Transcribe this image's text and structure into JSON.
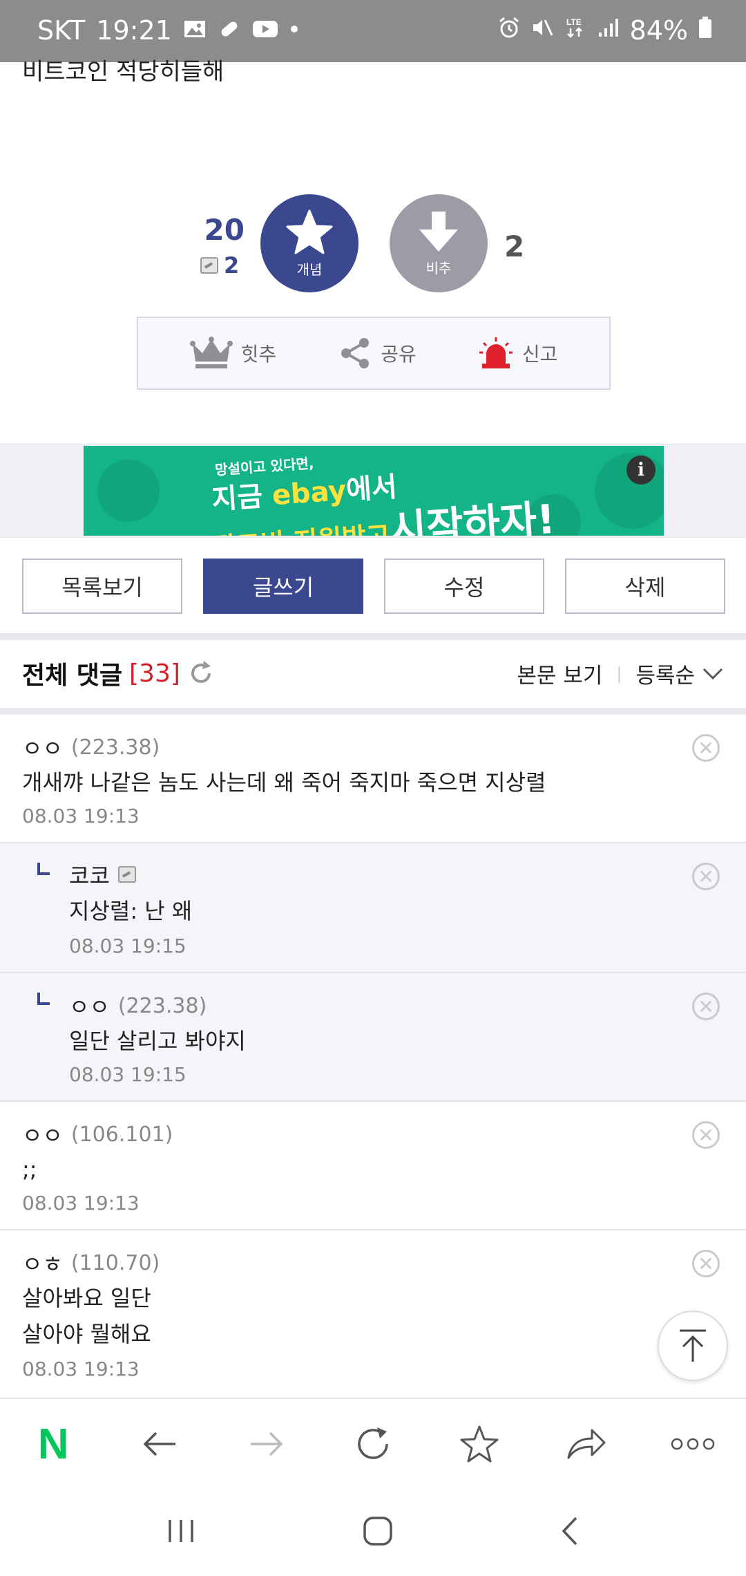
{
  "status_bar": {
    "carrier": "SKT",
    "time": "19:21",
    "network": "LTE",
    "battery": "84%"
  },
  "post": {
    "text_partial": "비트코인 적당히들해"
  },
  "recommend": {
    "up_count": "20",
    "fix_count": "2",
    "up_label": "개념",
    "down_label": "비추",
    "down_count": "2"
  },
  "actions": {
    "hit": "힛추",
    "share": "공유",
    "report": "신고"
  },
  "ad": {
    "line1": "망설이고 있다면,",
    "line2a": "지금 ",
    "line2b": "ebay",
    "line2c": "에서",
    "line3a": "광고비 지원받고",
    "line3b": "시작하자!",
    "info": "i"
  },
  "buttons": {
    "list": "목록보기",
    "write": "글쓰기",
    "edit": "수정",
    "delete": "삭제"
  },
  "comments_header": {
    "title": "전체 댓글",
    "count": "[33]",
    "view_body": "본문 보기",
    "sort": "등록순"
  },
  "comments": [
    {
      "nick": "ㅇㅇ",
      "ip": "(223.38)",
      "text": "개새꺄 나같은 놈도 사는데 왜 죽어 죽지마 죽으면 지상렬",
      "date": "08.03 19:13"
    },
    {
      "nick": "코코",
      "ip": "",
      "text": "지상렬: 난 왜",
      "date": "08.03 19:15"
    },
    {
      "nick": "ㅇㅇ",
      "ip": "(223.38)",
      "text": "일단 살리고 봐야지",
      "date": "08.03 19:15"
    },
    {
      "nick": "ㅇㅇ",
      "ip": "(106.101)",
      "text": ";;",
      "date": "08.03 19:13"
    },
    {
      "nick": "ㅇㅎ",
      "ip": "(110.70)",
      "text": "살아봐요 일단\n살아야 뭘해요",
      "date": "08.03 19:13"
    }
  ],
  "toolbar": {
    "naver": "N"
  },
  "colors": {
    "accent": "#3b4890",
    "ad_green": "#13b487",
    "count_red": "#d0202a"
  }
}
